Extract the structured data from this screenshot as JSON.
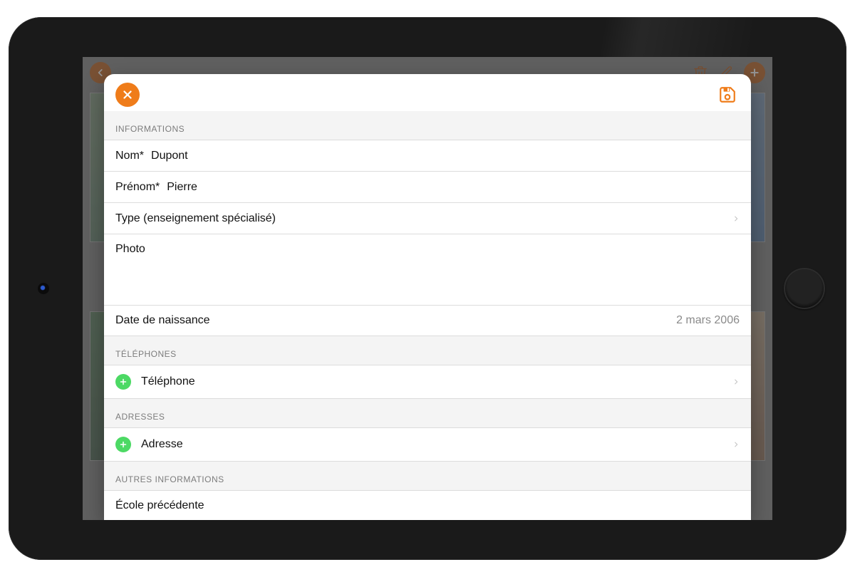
{
  "background_toolbar": {
    "back": "back",
    "trash": "trash",
    "edit": "edit",
    "add": "add"
  },
  "modal": {
    "close": "close",
    "save": "save",
    "sections": {
      "informations": {
        "title": "INFORMATIONS",
        "nom_label": "Nom*",
        "nom_value": "Dupont",
        "prenom_label": "Prénom*",
        "prenom_value": "Pierre",
        "type_label": "Type (enseignement spécialisé)",
        "photo_label": "Photo",
        "dob_label": "Date de naissance",
        "dob_value": "2 mars 2006"
      },
      "telephones": {
        "title": "TÉLÉPHONES",
        "add_label": "Téléphone"
      },
      "adresses": {
        "title": "ADRESSES",
        "add_label": "Adresse"
      },
      "autres": {
        "title": "AUTRES INFORMATIONS",
        "ecole_label": "École précédente"
      }
    }
  }
}
